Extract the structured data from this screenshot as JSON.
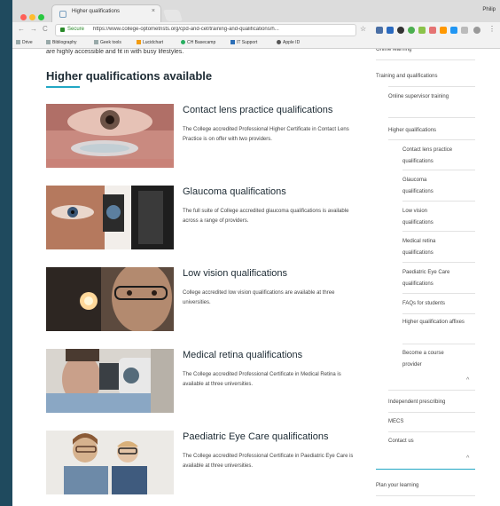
{
  "browser": {
    "tab_title": "Higher qualifications",
    "tab_close": "×",
    "user_name": "Philip",
    "secure_label": "Secure",
    "url": "https://www.college-optometrists.org/cpd-and-cet/training-and-qualifications/h...",
    "nav_back": "←",
    "nav_forward": "→",
    "nav_reload": "C",
    "bookmark_star": "☆",
    "more_menu": "⋮",
    "bookmarks": [
      "Drive",
      "Bibliography",
      "Geek tools",
      "Lucidchart",
      "CH Basecamp",
      "IT Support",
      "Apple ID"
    ]
  },
  "page": {
    "intro_text": "are highly accessible and fit in with busy lifestyles.",
    "heading": "Higher qualifications available",
    "items": [
      {
        "title": "Contact lens practice qualifications",
        "desc": "The College accredited Professional Higher Certificate in Contact Lens Practice is on offer with two providers."
      },
      {
        "title": "Glaucoma qualifications",
        "desc": "The full suite of College accredited glaucoma qualifications is available across a range of providers."
      },
      {
        "title": "Low vision qualifications",
        "desc": "College accredited low vision qualifications are available at three universities."
      },
      {
        "title": "Medical retina qualifications",
        "desc": "The College accredited Professional Certificate in Medical Retina is available at three universities."
      },
      {
        "title": "Paediatric Eye Care qualifications",
        "desc": "The College accredited Professional Certificate in Paediatric Eye Care is available at three universities."
      }
    ]
  },
  "sidebar": {
    "online_learning": "Online learning",
    "training": "Training and qualifications",
    "online_supervisor": "Online supervisor training",
    "higher": "Higher qualifications",
    "sub": [
      "Contact lens practice qualifications",
      "Glaucoma qualifications",
      "Low vision qualifications",
      "Medical retina qualifications",
      "Paediatric Eye Care qualifications"
    ],
    "faqs": "FAQs for students",
    "affixes": "Higher qualification affixes",
    "provider": "Become a course provider",
    "chevron": "^",
    "independent": "Independent prescribing",
    "mecs": "MECS",
    "contact": "Contact us",
    "plan": "Plan your learning"
  },
  "colors": {
    "accent": "#22a7c4",
    "heading": "#1c2a33",
    "page_bg": "#1f4a5e"
  }
}
